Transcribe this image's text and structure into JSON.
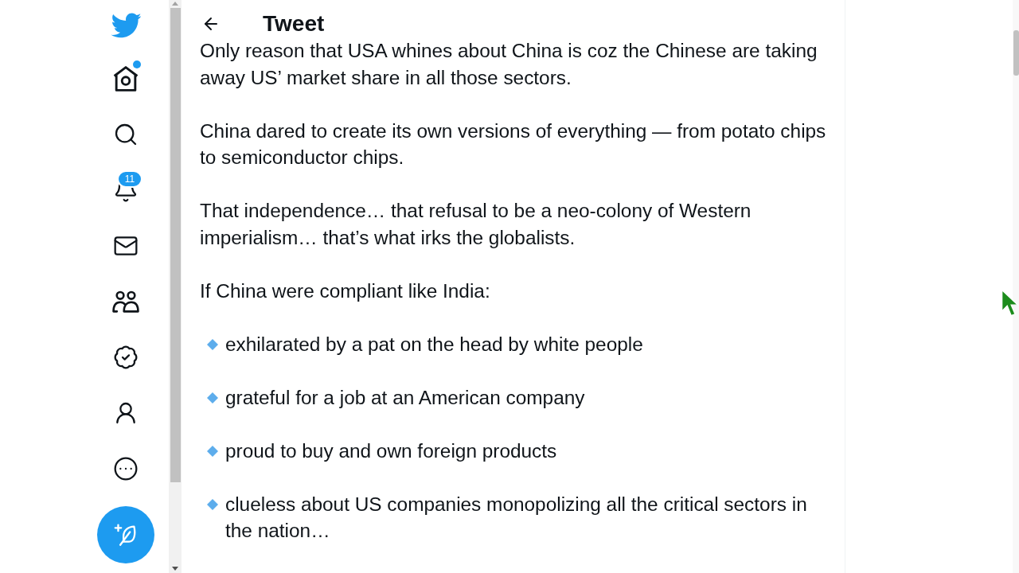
{
  "sidebar": {
    "items": [
      {
        "kind": "logo",
        "dot": false
      },
      {
        "kind": "home",
        "dot": true
      },
      {
        "kind": "search",
        "dot": false
      },
      {
        "kind": "notifications",
        "dot": false,
        "badge": "11"
      },
      {
        "kind": "messages",
        "dot": false
      },
      {
        "kind": "communities",
        "dot": false
      },
      {
        "kind": "verified",
        "dot": false
      },
      {
        "kind": "profile",
        "dot": false
      },
      {
        "kind": "more",
        "dot": false
      },
      {
        "kind": "compose",
        "dot": false
      }
    ]
  },
  "header": {
    "title": "Tweet"
  },
  "body": [
    {
      "kind": "paragraph",
      "text": "Only reason that USA whines about China is coz the Chinese are taking away US’ market share in all those sectors."
    },
    {
      "kind": "paragraph",
      "text": "China dared to create its own versions of everything — from potato chips to semiconductor chips."
    },
    {
      "kind": "paragraph",
      "text": "That independence… that refusal to be a neo-colony of Western imperialism… that’s what irks the globalists."
    },
    {
      "kind": "paragraph",
      "text": "If China were compliant like India:"
    },
    {
      "kind": "bullet",
      "text": "exhilarated by a pat on the head by white people"
    },
    {
      "kind": "bullet",
      "text": "grateful for a job at an American company"
    },
    {
      "kind": "bullet",
      "text": "proud to buy and own foreign products"
    },
    {
      "kind": "bullet",
      "text": "clueless about US companies monopolizing all the critical sectors in the nation…"
    }
  ]
}
